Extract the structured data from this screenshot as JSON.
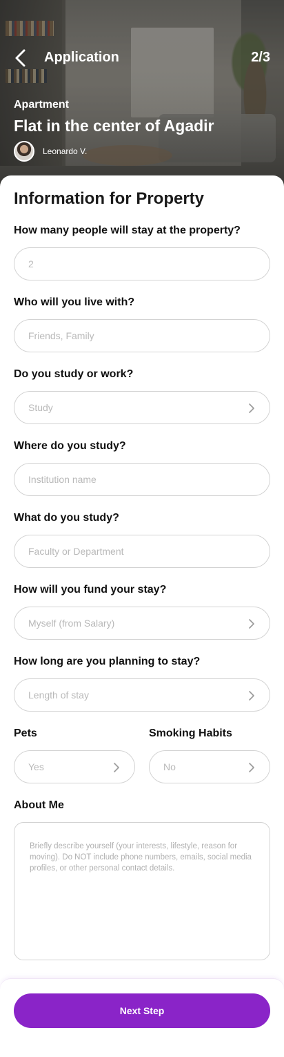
{
  "header": {
    "title": "Application",
    "step": "2/3",
    "back_icon": "chevron-left-icon"
  },
  "property": {
    "type": "Apartment",
    "title": "Flat in the center of Agadir",
    "owner_name": "Leonardo V."
  },
  "form": {
    "section_title": "Information for Property",
    "people": {
      "label": "How many people will stay at the property?",
      "placeholder": "2"
    },
    "live_with": {
      "label": "Who will you live with?",
      "placeholder": "Friends, Family"
    },
    "study_work": {
      "label": "Do you study or work?",
      "placeholder": "Study"
    },
    "study_where": {
      "label": "Where do you study?",
      "placeholder": "Institution name"
    },
    "study_what": {
      "label": "What do you study?",
      "placeholder": "Faculty or Department"
    },
    "fund": {
      "label": "How will you fund your stay?",
      "placeholder": "Myself (from Salary)"
    },
    "length": {
      "label": "How long are you planning to stay?",
      "placeholder": "Length of stay"
    },
    "pets": {
      "label": "Pets",
      "placeholder": "Yes"
    },
    "smoking": {
      "label": "Smoking Habits",
      "placeholder": "No"
    },
    "about": {
      "label": "About Me",
      "placeholder": "Briefly describe yourself (your interests, lifestyle, reason for moving). Do NOT include phone numbers, emails, social media profiles, or other personal contact details."
    }
  },
  "footer": {
    "next_label": "Next Step"
  },
  "colors": {
    "accent": "#8a24c8",
    "field_border": "#d3d3d3",
    "placeholder": "#b9b9b9"
  }
}
